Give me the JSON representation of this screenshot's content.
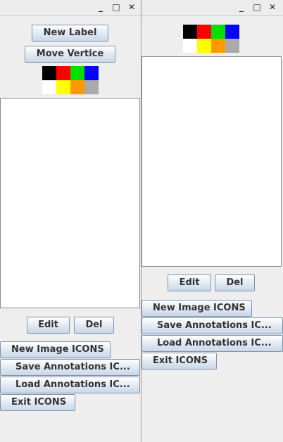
{
  "window_controls": {
    "minimize": "_",
    "maximize": "□",
    "close": "✕"
  },
  "left": {
    "buttons": {
      "new_label": "New Label",
      "move_vertice": "Move Vertice",
      "edit": "Edit",
      "del": "Del",
      "new_image": "New Image ICONS",
      "save_annotations": "Save Annotations IC...",
      "load_annotations": "Load Annotations IC...",
      "exit": "Exit ICONS"
    }
  },
  "right": {
    "buttons": {
      "edit": "Edit",
      "del": "Del",
      "new_image": "New Image ICONS",
      "save_annotations": "Save Annotations IC...",
      "load_annotations": "Load Annotations IC...",
      "exit": "Exit ICONS"
    }
  },
  "palette_colors": [
    "#000000",
    "#ff0000",
    "#00e000",
    "#0000ff",
    "#ffffff",
    "#ffff00",
    "#ff9900",
    "#aaaaaa"
  ]
}
